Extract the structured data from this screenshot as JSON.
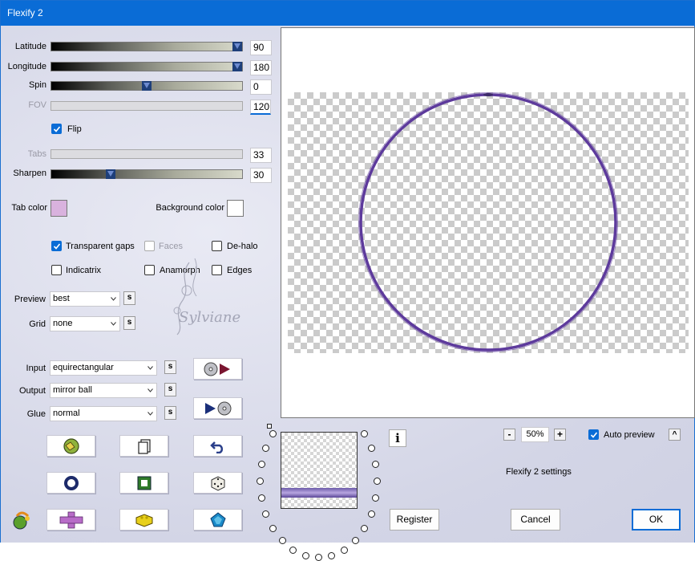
{
  "window": {
    "title": "Flexify 2"
  },
  "sliders": {
    "latitude": {
      "label": "Latitude",
      "value": "90",
      "fraction": 1.0
    },
    "longitude": {
      "label": "Longitude",
      "value": "180",
      "fraction": 1.0
    },
    "spin": {
      "label": "Spin",
      "value": "0",
      "fraction": 0.5
    },
    "fov": {
      "label": "FOV",
      "value": "120"
    },
    "tabs": {
      "label": "Tabs",
      "value": "33"
    },
    "sharpen": {
      "label": "Sharpen",
      "value": "30",
      "fraction": 0.3
    }
  },
  "flip": {
    "label": "Flip",
    "checked": true
  },
  "colors": {
    "tab_color_label": "Tab color",
    "tab_color": "#d9b2de",
    "background_color_label": "Background color",
    "background_color": "#ffffff"
  },
  "options": {
    "transparent_gaps": "Transparent gaps",
    "faces": "Faces",
    "de_halo": "De-halo",
    "indicatrix": "Indicatrix",
    "anamorph": "Anamorph",
    "edges": "Edges"
  },
  "preview_select": {
    "label": "Preview",
    "value": "best"
  },
  "grid_select": {
    "label": "Grid",
    "value": "none"
  },
  "input_select": {
    "label": "Input",
    "value": "equirectangular"
  },
  "output_select": {
    "label": "Output",
    "value": "mirror ball"
  },
  "glue_select": {
    "label": "Glue",
    "value": "normal"
  },
  "sync_label": "s",
  "watermark": "Sylviane",
  "zoom": {
    "value": "50%",
    "minus": "-",
    "plus": "+"
  },
  "auto_preview": {
    "label": "Auto preview",
    "checked": true
  },
  "settings_label": "Flexify 2 settings",
  "buttons": {
    "register": "Register",
    "cancel": "Cancel",
    "ok": "OK",
    "info": "i",
    "collapse": "^"
  },
  "accent": "#0a6cd6",
  "ring_color": "#5d3a9c"
}
